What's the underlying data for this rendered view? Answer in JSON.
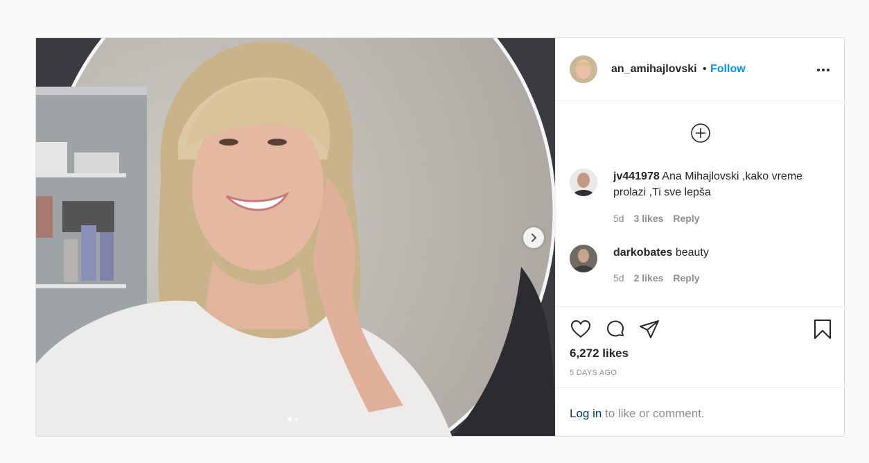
{
  "post": {
    "username": "an_amihajlovski",
    "separator": "•",
    "follow_label": "Follow",
    "carousel": {
      "slide_count": 2,
      "active_slide": 1
    }
  },
  "comments": [
    {
      "username": "jv441978",
      "text": "Ana Mihajlovski ,kako vreme prolazi ,Ti sve lepša",
      "age": "5d",
      "likes": "3 likes",
      "reply_label": "Reply"
    },
    {
      "username": "darkobates",
      "text": "beauty",
      "age": "5d",
      "likes": "2 likes",
      "reply_label": "Reply"
    }
  ],
  "engagement": {
    "likes": "6,272 likes",
    "posted": "5 DAYS AGO"
  },
  "footer": {
    "login_link": "Log in",
    "login_rest": " to like or comment."
  },
  "icons": [
    "next-arrow-icon",
    "more-options-icon",
    "load-more-comments-icon",
    "heart-icon",
    "comment-icon",
    "share-icon",
    "bookmark-icon"
  ],
  "colors": {
    "link_blue": "#0095f6",
    "login_blue": "#00376b",
    "muted": "#8e8e8e"
  }
}
